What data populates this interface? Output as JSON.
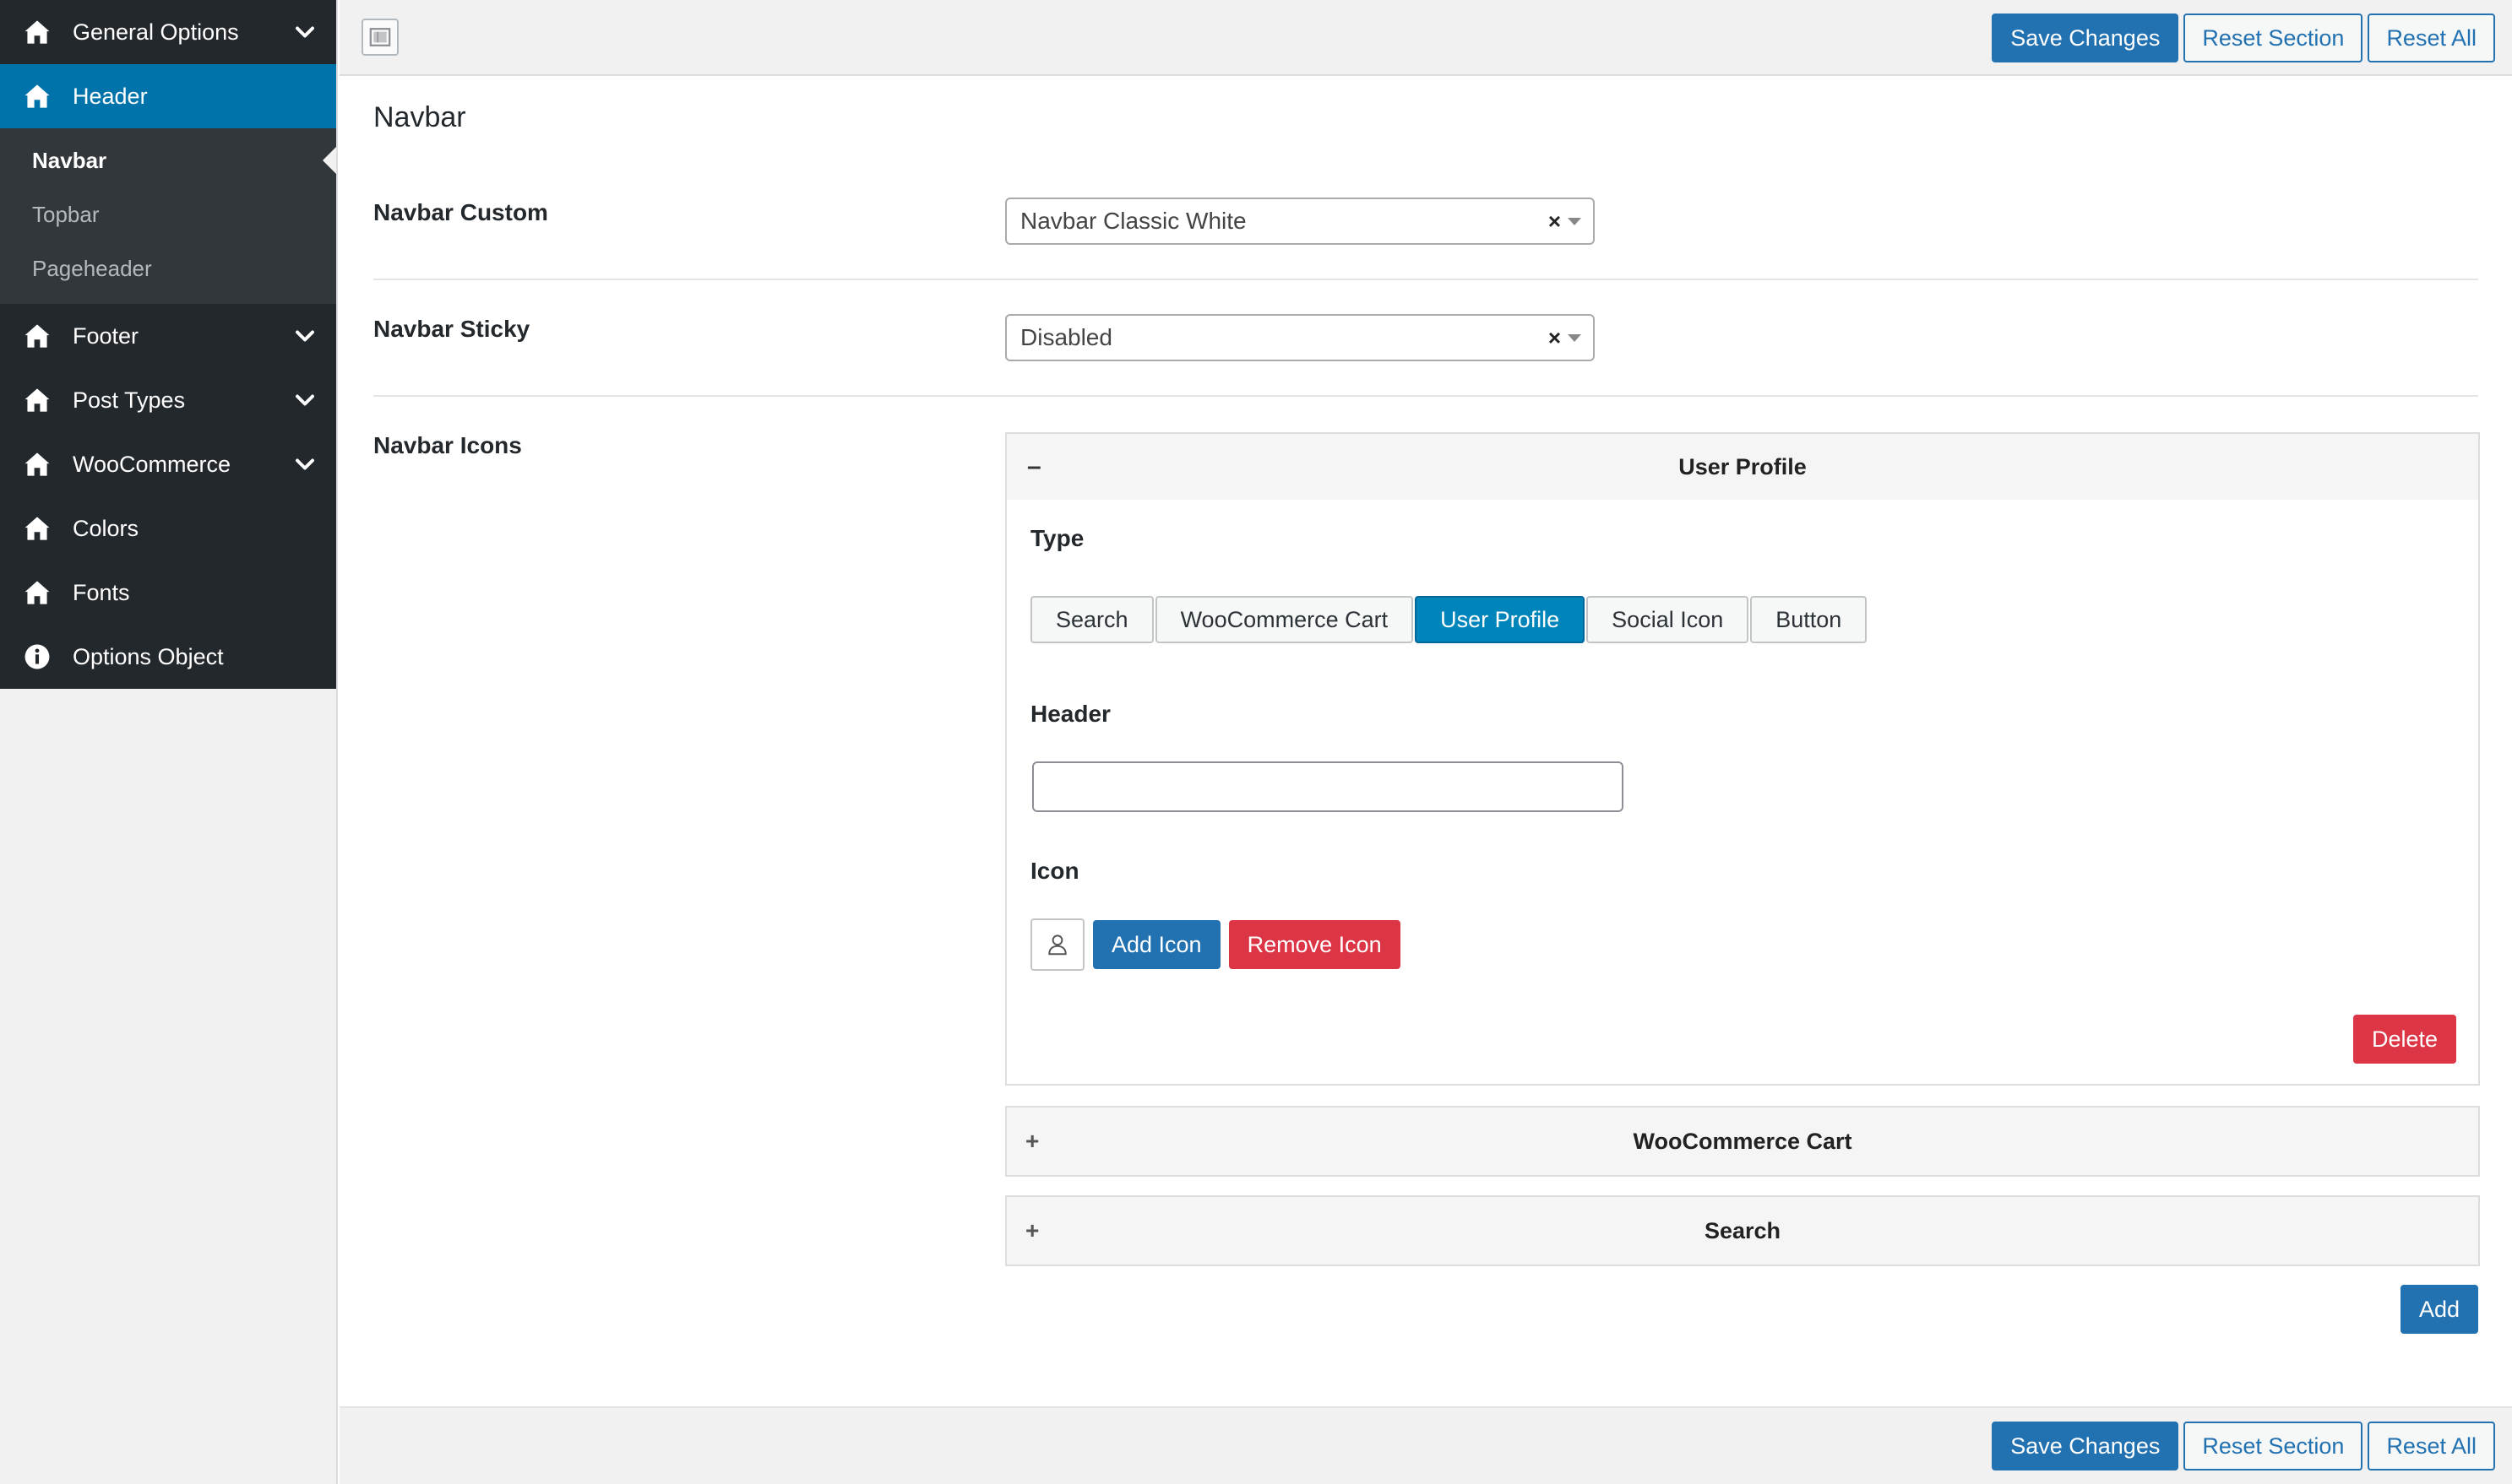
{
  "sidebar": {
    "items": [
      {
        "label": "General Options",
        "icon": "home-icon",
        "expandable": true
      },
      {
        "label": "Header",
        "icon": "home-icon",
        "active": true
      },
      {
        "label": "Footer",
        "icon": "home-icon",
        "expandable": true
      },
      {
        "label": "Post Types",
        "icon": "home-icon",
        "expandable": true
      },
      {
        "label": "WooCommerce",
        "icon": "home-icon",
        "expandable": true
      },
      {
        "label": "Colors",
        "icon": "home-icon"
      },
      {
        "label": "Fonts",
        "icon": "home-icon"
      },
      {
        "label": "Options Object",
        "icon": "info-icon"
      }
    ],
    "submenu": [
      {
        "label": "Navbar",
        "current": true
      },
      {
        "label": "Topbar"
      },
      {
        "label": "Pageheader"
      }
    ]
  },
  "toolbar": {
    "save_label": "Save Changes",
    "reset_section_label": "Reset Section",
    "reset_all_label": "Reset All"
  },
  "section": {
    "title": "Navbar"
  },
  "fields": {
    "navbar_custom": {
      "label": "Navbar Custom",
      "value": "Navbar Classic White",
      "clear": "×"
    },
    "navbar_sticky": {
      "label": "Navbar Sticky",
      "value": "Disabled",
      "clear": "×"
    },
    "navbar_icons": {
      "label": "Navbar Icons"
    }
  },
  "repeater": {
    "open_item": {
      "toggle": "–",
      "title": "User Profile",
      "type_label": "Type",
      "type_options": [
        "Search",
        "WooCommerce Cart",
        "User Profile",
        "Social Icon",
        "Button"
      ],
      "type_selected": "User Profile",
      "header_label": "Header",
      "header_value": "",
      "icon_label": "Icon",
      "icon_preview": "user-icon",
      "add_icon_label": "Add Icon",
      "remove_icon_label": "Remove Icon",
      "delete_label": "Delete"
    },
    "collapsed_items": [
      {
        "toggle": "+",
        "title": "WooCommerce Cart"
      },
      {
        "toggle": "+",
        "title": "Search"
      }
    ],
    "add_label": "Add"
  },
  "colors": {
    "sidebar_bg": "#23282d",
    "sidebar_active": "#0073aa",
    "primary": "#2271b1",
    "segment_active": "#0085ba",
    "danger": "#dc3545"
  }
}
